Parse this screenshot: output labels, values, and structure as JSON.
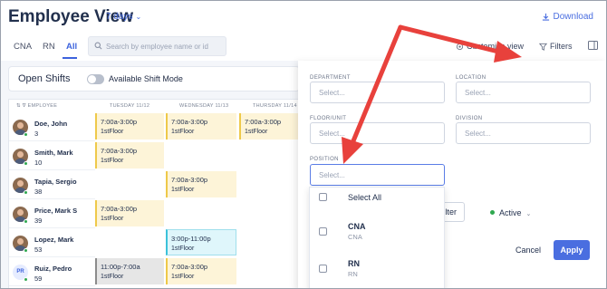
{
  "header": {
    "title": "Employee View",
    "range": "7 days",
    "download": "Download"
  },
  "toolbar": {
    "tabs": [
      "CNA",
      "RN",
      "All"
    ],
    "active_tab": "All",
    "search_placeholder": "Search by employee name or id",
    "customize": "Customize view",
    "filters": "Filters"
  },
  "open_shifts": {
    "title": "Open Shifts",
    "toggle_label": "Available Shift Mode",
    "toggle_on": false
  },
  "grid": {
    "col_employee": "EMPLOYEE",
    "days": [
      "TUESDAY 11/12",
      "WEDNESDAY 11/13",
      "THURSDAY 11/14"
    ],
    "employees": [
      {
        "name": "Doe, John",
        "num": "3"
      },
      {
        "name": "Smith, Mark",
        "num": "10"
      },
      {
        "name": "Tapia, Sergio",
        "num": "38"
      },
      {
        "name": "Price, Mark S",
        "num": "39"
      },
      {
        "name": "Lopez, Mark",
        "num": "53"
      },
      {
        "name": "Ruiz, Pedro",
        "num": "59",
        "initials": "PR"
      }
    ],
    "shifts": [
      {
        "row": 0,
        "col": 0,
        "time": "7:00a-3:00p",
        "loc": "1stFloor",
        "style": "yellow"
      },
      {
        "row": 0,
        "col": 1,
        "time": "7:00a-3:00p",
        "loc": "1stFloor",
        "style": "yellow"
      },
      {
        "row": 0,
        "col": 2,
        "time": "7:00a-3:00p",
        "loc": "1stFloor",
        "style": "yellow"
      },
      {
        "row": 1,
        "col": 0,
        "time": "7:00a-3:00p",
        "loc": "1stFloor",
        "style": "yellow"
      },
      {
        "row": 2,
        "col": 1,
        "time": "7:00a-3:00p",
        "loc": "1stFloor",
        "style": "yellow"
      },
      {
        "row": 3,
        "col": 0,
        "time": "7:00a-3:00p",
        "loc": "1stFloor",
        "style": "yellow"
      },
      {
        "row": 4,
        "col": 1,
        "time": "3:00p-11:00p",
        "loc": "1stFloor",
        "style": "cyan"
      },
      {
        "row": 5,
        "col": 0,
        "time": "11:00p-7:00a",
        "loc": "1stFloor",
        "style": "gray"
      },
      {
        "row": 5,
        "col": 1,
        "time": "7:00a-3:00p",
        "loc": "1stFloor",
        "style": "yellow"
      }
    ]
  },
  "filters": {
    "department_label": "DEPARTMENT",
    "location_label": "LOCATION",
    "floor_label": "FLOOR/UNIT",
    "division_label": "DIVISION",
    "position_label": "POSITION",
    "placeholder": "Select...",
    "ghost_button": "lter",
    "status": "Active",
    "cancel": "Cancel",
    "apply": "Apply",
    "options": [
      {
        "label": "Select All"
      },
      {
        "label": "CNA",
        "sub": "CNA"
      },
      {
        "label": "RN",
        "sub": "RN"
      }
    ]
  },
  "colors": {
    "accent": "#4a6ee0",
    "arrow": "#e8413c",
    "shift_yellow": "#fdf4d8",
    "shift_cyan": "#dff6fb",
    "shift_gray": "#e6e6e6",
    "active_dot": "#2fa84f"
  }
}
